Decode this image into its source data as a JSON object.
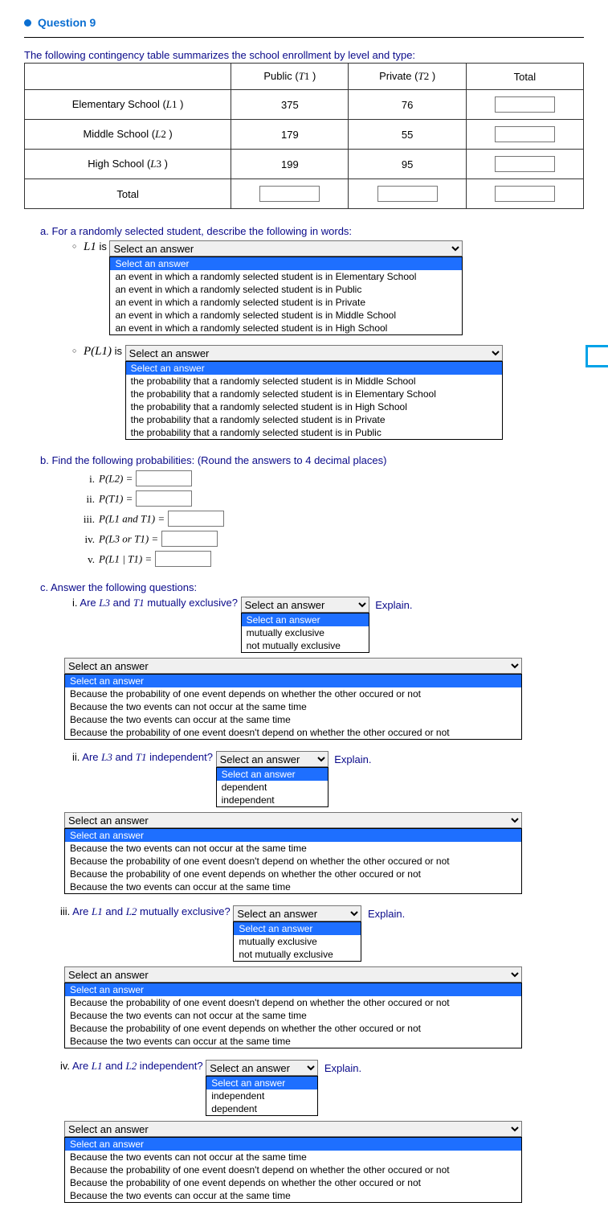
{
  "header": {
    "title": "Question 9"
  },
  "intro": [
    "The following contingency table summarizes the school enrollment by level and type:"
  ],
  "table": {
    "cols": [
      "",
      "Public (T1 )",
      "Private (T2 )",
      "Total"
    ],
    "rows": [
      {
        "label": "Elementary School (L1 )",
        "c1": "375",
        "c2": "76"
      },
      {
        "label": "Middle School (L2 )",
        "c1": "179",
        "c2": "55"
      },
      {
        "label": "High School (L3 )",
        "c1": "199",
        "c2": "95"
      },
      {
        "label": "Total"
      }
    ]
  },
  "a": {
    "title": "a. For a randomly selected student, describe the following in words:",
    "l1_label": "L1",
    "l1_is": "is",
    "sel_placeholder": "Select an answer",
    "l1_opts": [
      "Select an answer",
      "an event in which a randomly selected student is in Elementary School",
      "an event in which a randomly selected student is in Public",
      "an event in which a randomly selected student is in Private",
      "an event in which a randomly selected student is in Middle School",
      "an event in which a randomly selected student is in High School"
    ],
    "pl1_label": "P(L1)",
    "pl1_is": "is",
    "pl1_opts": [
      "Select an answer",
      "the probability that a randomly selected student is in Middle School",
      "the probability that a randomly selected student is in Elementary School",
      "the probability that a randomly selected student is in High School",
      "the probability that a randomly selected student is in Private",
      "the probability that a randomly selected student is in Public"
    ]
  },
  "b": {
    "title": "b. Find the following probabilities: (Round the answers to 4 decimal places)",
    "items": [
      {
        "num": "i.",
        "expr": "P(L2) ="
      },
      {
        "num": "ii.",
        "expr": "P(T1) ="
      },
      {
        "num": "iii.",
        "expr": "P(L1 and T1) ="
      },
      {
        "num": "iv.",
        "expr": "P(L3 or T1) ="
      },
      {
        "num": "v.",
        "expr": "P(L1 | T1) ="
      }
    ]
  },
  "c": {
    "title": "c. Answer the following questions:",
    "explain": "Explain.",
    "me_opts": [
      "Select an answer",
      "mutually exclusive",
      "not mutually exclusive"
    ],
    "ind_opts": [
      "Select an answer",
      "dependent",
      "independent"
    ],
    "ind_opts2": [
      "Select an answer",
      "independent",
      "dependent"
    ],
    "reason_a": [
      "Select an answer",
      "Because the probability of one event depends on whether the other occured or not",
      "Because the two events can not occur at the same time",
      "Because the two events can occur at the same time",
      "Because the probability of one event doesn't depend on whether the other occured or not"
    ],
    "reason_b": [
      "Select an answer",
      "Because the two events can not occur at the same time",
      "Because the probability of one event doesn't depend on whether the other occured or not",
      "Because the probability of one event depends on whether the other occured or not",
      "Because the two events can occur at the same time"
    ],
    "reason_c": [
      "Select an answer",
      "Because the probability of one event doesn't depend on whether the other occured or not",
      "Because the two events can not occur at the same time",
      "Because the probability of one event depends on whether the other occured or not",
      "Because the two events can occur at the same time"
    ],
    "reason_d": [
      "Select an answer",
      "Because the two events can not occur at the same time",
      "Because the probability of one event doesn't depend on whether the other occured or not",
      "Because the probability of one event depends on whether the other occured or not",
      "Because the two events can occur at the same time"
    ],
    "q1": {
      "num": "i.",
      "text": "Are L3 and T1 mutually exclusive?"
    },
    "q2": {
      "num": "ii.",
      "text": "Are L3 and T1 independent?"
    },
    "q3": {
      "num": "iii.",
      "text": "Are L1  and L2  mutually exclusive?"
    },
    "q4": {
      "num": "iv.",
      "text": "Are L1  and L2  independent?"
    }
  }
}
